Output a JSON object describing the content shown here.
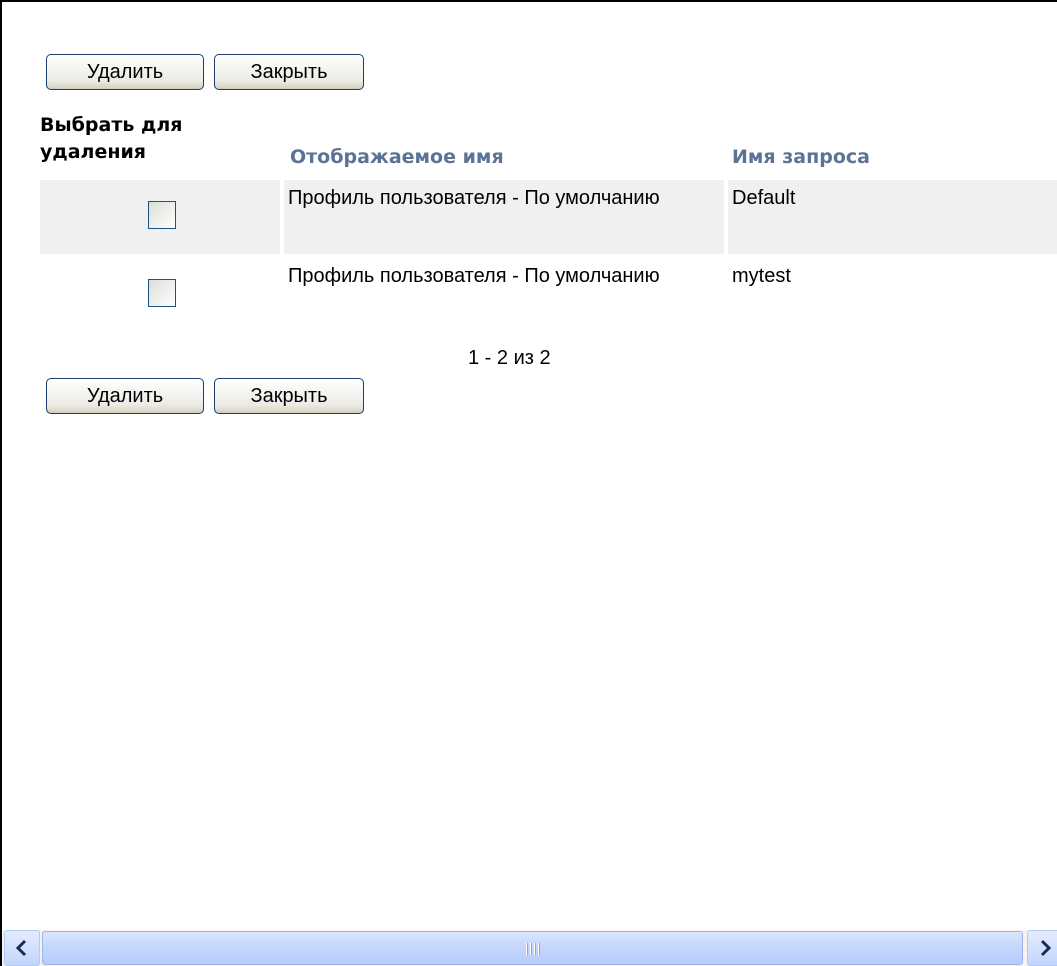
{
  "toolbar_top": {
    "delete_label": "Удалить",
    "close_label": "Закрыть"
  },
  "table": {
    "headers": {
      "select": "Выбрать для удаления",
      "display_name": "Отображаемое имя",
      "query_name": "Имя запроса"
    },
    "rows": [
      {
        "checked": false,
        "display_name": "Профиль пользователя - По умолчанию",
        "query_name": "Default"
      },
      {
        "checked": false,
        "display_name": "Профиль пользователя - По умолчанию",
        "query_name": "mytest"
      }
    ]
  },
  "pagination": {
    "text": "1 - 2 из 2"
  },
  "toolbar_bottom": {
    "delete_label": "Удалить",
    "close_label": "Закрыть"
  },
  "colors": {
    "header_link": "#5b7395",
    "row_shade": "#f0f0f0",
    "button_border": "#1c3f6e",
    "scrollbar": "#c4d6fd"
  }
}
